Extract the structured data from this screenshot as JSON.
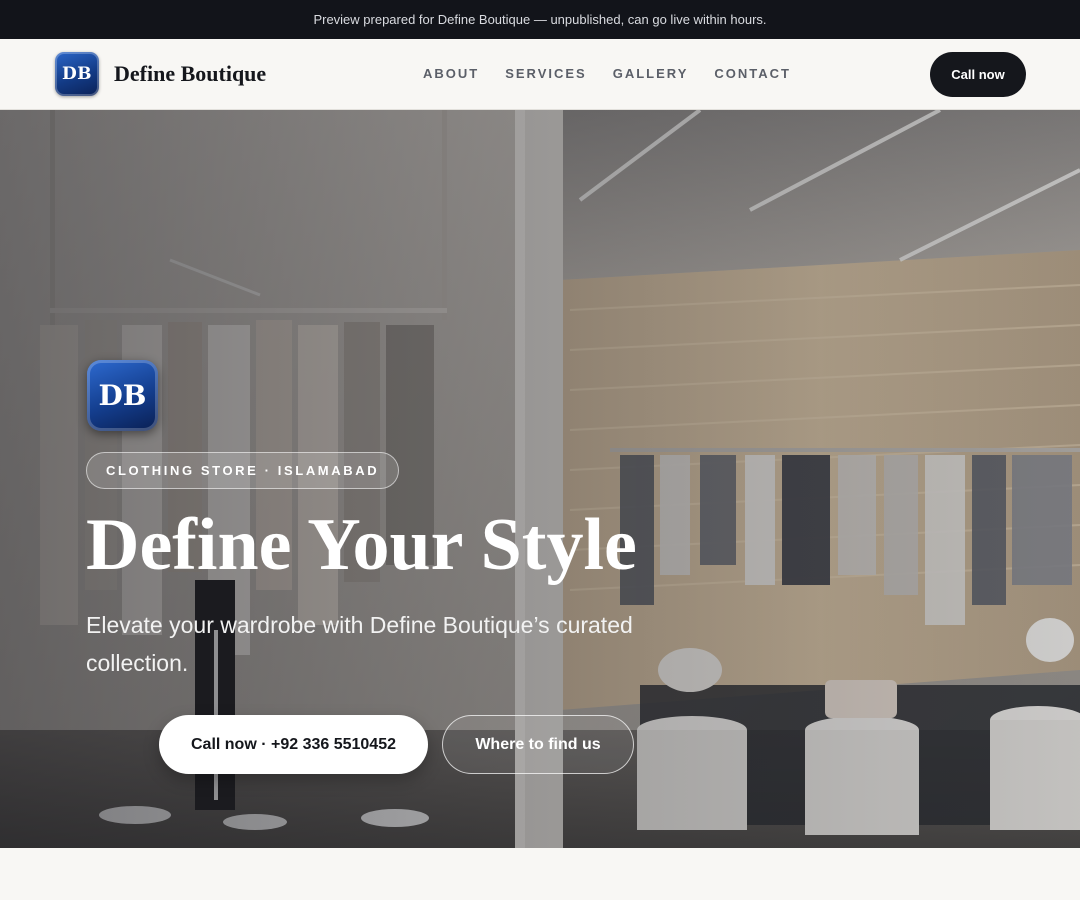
{
  "announcement": "Preview prepared for Define Boutique — unpublished, can go live within hours.",
  "brand": {
    "logo_text": "DB",
    "name": "Define Boutique",
    "logo_colors": [
      "#2b66c8",
      "#133b86",
      "#0b2156"
    ]
  },
  "nav": {
    "links": [
      "ABOUT",
      "SERVICES",
      "GALLERY",
      "CONTACT"
    ],
    "cta_label": "Call now"
  },
  "hero": {
    "logo_text": "DB",
    "badge": "CLOTHING STORE · ISLAMABAD",
    "title": "Define Your Style",
    "subtitle": "Elevate your wardrobe with Define Boutique’s curated collection.",
    "primary_button": "Call now · +92 336 5510452",
    "secondary_button": "Where to find us",
    "background_image": "boutique-interior-photo"
  },
  "colors": {
    "dark": "#15171c",
    "announce_bg": "#12141a",
    "page_bg": "#f8f7f4"
  }
}
